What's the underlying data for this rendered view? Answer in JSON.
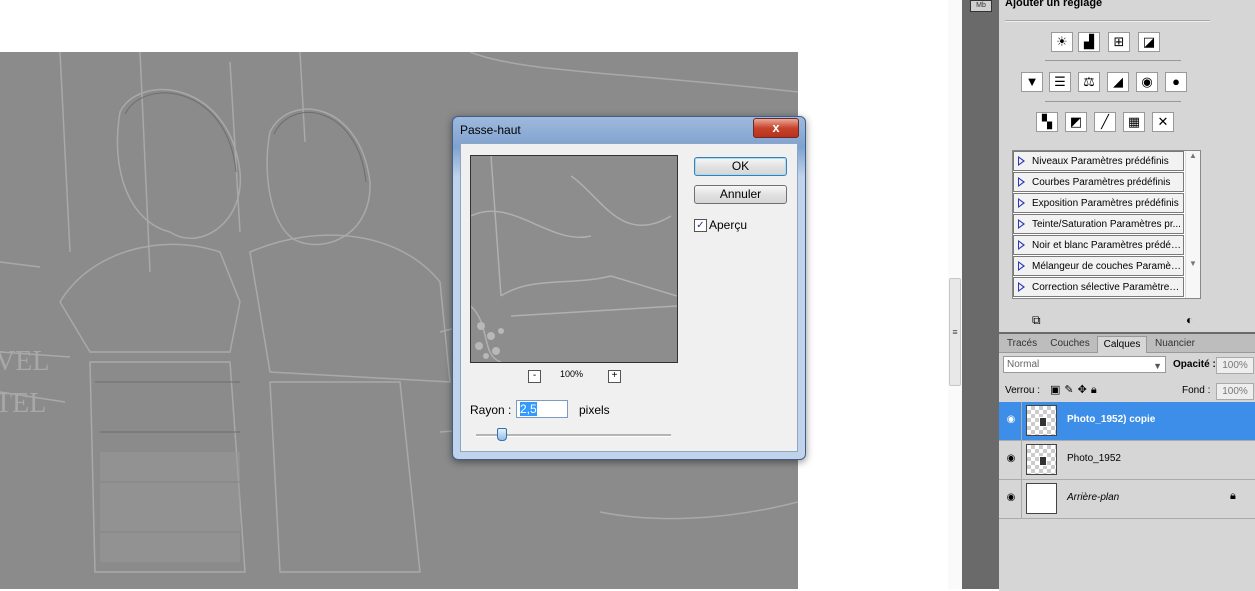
{
  "dialog": {
    "title": "Passe-haut",
    "close_glyph": "x",
    "ok_label": "OK",
    "cancel_label": "Annuler",
    "preview_label": "Aperçu",
    "preview_checked": true,
    "zoom_out": "-",
    "zoom_in": "+",
    "zoom_level": "100%",
    "radius_label": "Rayon :",
    "radius_value": "2,5",
    "radius_unit": "pixels"
  },
  "adjustments": {
    "title": "Ajouter un réglage",
    "presets": [
      "Niveaux Paramètres prédéfinis",
      "Courbes Paramètres prédéfinis",
      "Exposition Paramètres prédéfinis",
      "Teinte/Saturation Paramètres pr...",
      "Noir et blanc Paramètres prédéfi...",
      "Mélangeur de couches Paramètr...",
      "Correction sélective Paramètres ..."
    ]
  },
  "layers": {
    "tabs": [
      "Tracés",
      "Couches",
      "Calques",
      "Nuancier"
    ],
    "active_tab": "Calques",
    "blend_mode": "Normal",
    "opacity_label": "Opacité :",
    "opacity_value": "100%",
    "lock_label": "Verrou :",
    "fill_label": "Fond :",
    "fill_value": "100%",
    "items": [
      {
        "name": "Photo_1952) copie",
        "selected": true
      },
      {
        "name": "Photo_1952",
        "selected": false
      },
      {
        "name": "Arrière-plan",
        "selected": false
      }
    ]
  },
  "dock": {
    "panel_badge": "Mb"
  }
}
